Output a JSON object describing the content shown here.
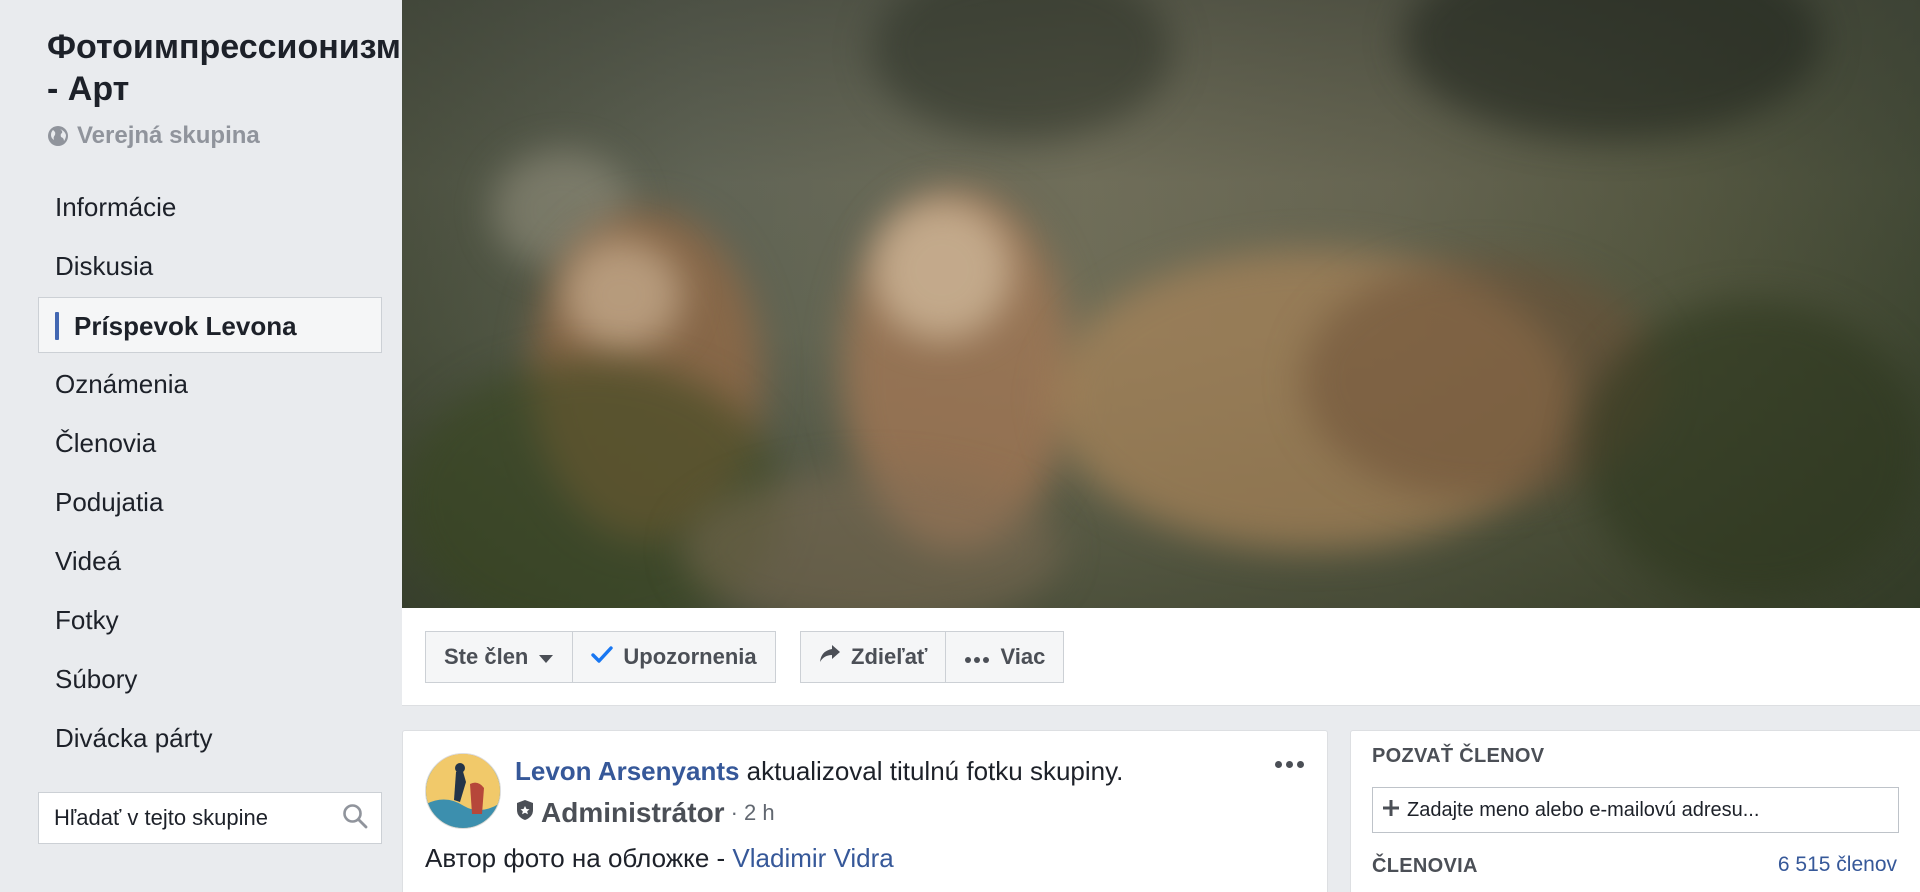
{
  "sidebar": {
    "group_name": "Фотоимпрессионизм - Арт",
    "privacy": "Verejná skupina",
    "nav": [
      {
        "label": "Informácie"
      },
      {
        "label": "Diskusia"
      },
      {
        "label": "Príspevok Levona",
        "active": true
      },
      {
        "label": "Oznámenia"
      },
      {
        "label": "Členovia"
      },
      {
        "label": "Podujatia"
      },
      {
        "label": "Videá"
      },
      {
        "label": "Fotky"
      },
      {
        "label": "Súbory"
      },
      {
        "label": "Divácka párty"
      }
    ],
    "search_placeholder": "Hľadať v tejto skupine"
  },
  "actions": {
    "member": "Ste člen",
    "notifications": "Upozornenia",
    "share": "Zdieľať",
    "more": "Viac"
  },
  "post": {
    "author": "Levon Arsenyants",
    "action_text": " aktualizoval titulnú fotku skupiny.",
    "role": "Administrátor",
    "time": "· 2 h",
    "body_text": "Автор фото на обложке - ",
    "body_link": "Vladimir Vidra"
  },
  "invite": {
    "heading": "POZVAŤ ČLENOV",
    "placeholder": "Zadajte meno alebo e-mailovú adresu...",
    "members_heading": "ČLENOVIA",
    "members_count": "6 515 členov"
  },
  "colors": {
    "accent": "#4267b2",
    "link": "#365899",
    "check": "#1877f2"
  }
}
